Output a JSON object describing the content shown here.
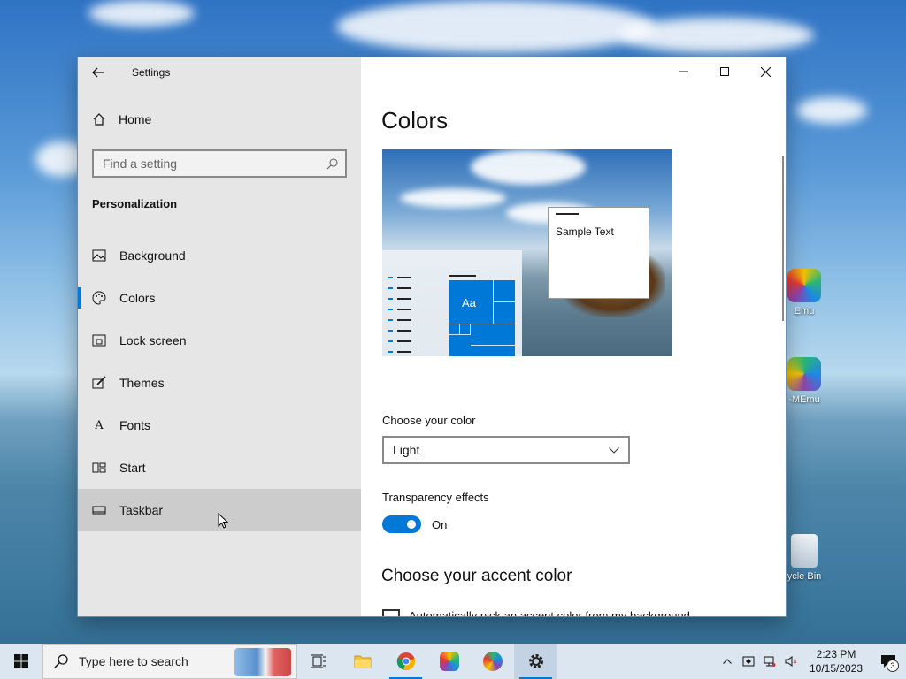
{
  "desktop": {
    "icons": [
      {
        "label": "Emu",
        "icon": "memu-icon"
      },
      {
        "label": "-MEmu",
        "icon": "memu-multi-icon"
      },
      {
        "label": "ycle Bin",
        "icon": "recycle-bin-icon"
      }
    ]
  },
  "window": {
    "title": "Settings",
    "controls": {
      "minimize": "minimize-icon",
      "maximize": "maximize-icon",
      "close": "close-icon"
    }
  },
  "sidebar": {
    "home_label": "Home",
    "search_placeholder": "Find a setting",
    "section_title": "Personalization",
    "items": [
      {
        "label": "Background",
        "icon": "picture-icon"
      },
      {
        "label": "Colors",
        "icon": "palette-icon",
        "active": true
      },
      {
        "label": "Lock screen",
        "icon": "lock-screen-icon"
      },
      {
        "label": "Themes",
        "icon": "brush-icon"
      },
      {
        "label": "Fonts",
        "icon": "fonts-icon"
      },
      {
        "label": "Start",
        "icon": "start-icon"
      },
      {
        "label": "Taskbar",
        "icon": "taskbar-icon",
        "hovered": true
      }
    ]
  },
  "main": {
    "title": "Colors",
    "preview": {
      "sample_text": "Sample Text",
      "tile_label": "Aa"
    },
    "choose_color_label": "Choose your color",
    "choose_color_value": "Light",
    "transparency_label": "Transparency effects",
    "transparency_state": "On",
    "accent_title": "Choose your accent color",
    "auto_pick_label": "Automatically pick an accent color from my background"
  },
  "taskbar": {
    "search_placeholder": "Type here to search",
    "apps": [
      "task-view-icon",
      "file-explorer-icon",
      "chrome-icon",
      "memu-icon",
      "memu-multi-icon",
      "settings-icon"
    ],
    "clock_time": "2:23 PM",
    "clock_date": "10/15/2023",
    "notification_count": "3"
  },
  "colors": {
    "accent": "#0078d7",
    "sidebar_bg": "#e6e6e6"
  }
}
